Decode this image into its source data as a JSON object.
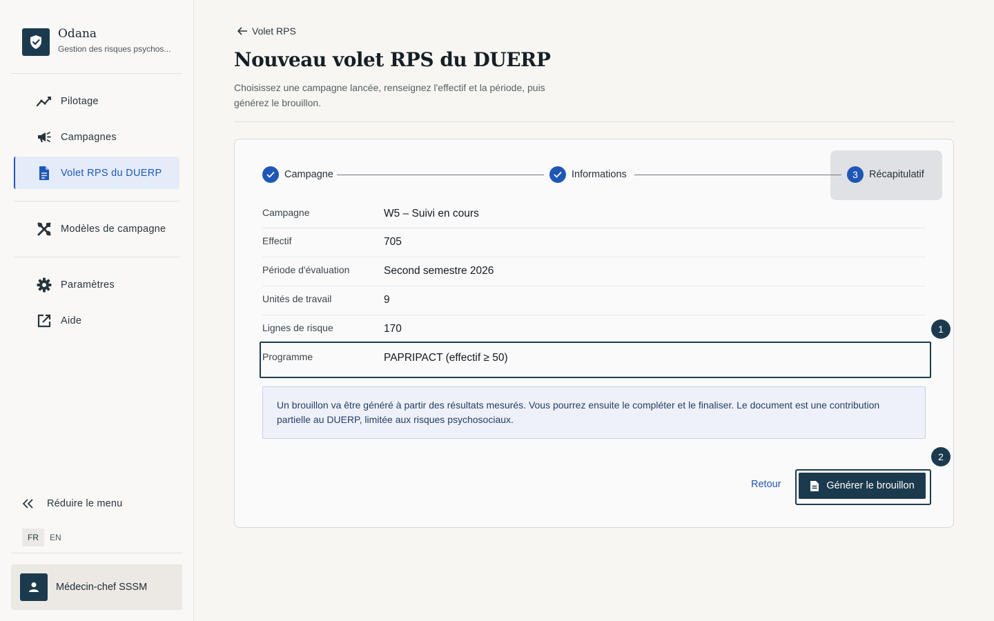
{
  "brand": {
    "name": "Odana",
    "subtitle": "Gestion des risques psychos..."
  },
  "sidebar": {
    "items": [
      {
        "label": "Pilotage",
        "icon": "chart-line-icon"
      },
      {
        "label": "Campagnes",
        "icon": "megaphone-icon"
      },
      {
        "label": "Volet RPS du DUERP",
        "icon": "document-icon",
        "active": true
      },
      {
        "label": "Modèles de campagne",
        "icon": "tools-icon"
      },
      {
        "label": "Paramètres",
        "icon": "gear-icon"
      },
      {
        "label": "Aide",
        "icon": "external-link-icon"
      }
    ],
    "collapse_label": "Réduire le menu",
    "languages": [
      "FR",
      "EN"
    ],
    "active_language": "FR",
    "user_name": "Médecin-chef SSSM"
  },
  "header": {
    "back_label": "Volet RPS",
    "title": "Nouveau volet RPS du DUERP",
    "description": "Choisissez une campagne lancée, renseignez l'effectif et la période, puis générez le brouillon."
  },
  "stepper": {
    "steps": [
      {
        "label": "Campagne",
        "state": "done"
      },
      {
        "label": "Informations",
        "state": "done"
      },
      {
        "label": "Récapitulatif",
        "state": "current",
        "number": "3"
      }
    ]
  },
  "summary": {
    "rows": [
      {
        "label": "Campagne",
        "value": "W5 – Suivi en cours"
      },
      {
        "label": "Effectif",
        "value": "705"
      },
      {
        "label": "Période d'évaluation",
        "value": "Second semestre 2026"
      },
      {
        "label": "Unités de travail",
        "value": "9"
      },
      {
        "label": "Lignes de risque",
        "value": "170"
      },
      {
        "label": "Programme",
        "value": "PAPRIPACT (effectif ≥ 50)"
      }
    ]
  },
  "info_text": "Un brouillon va être généré à partir des résultats mesurés. Vous pourrez ensuite le compléter et le finaliser. Le document est une contribution partielle au DUERP, limitée aux risques psychosociaux.",
  "actions": {
    "back_label": "Retour",
    "generate_label": "Générer le brouillon"
  },
  "annotations": [
    "1",
    "2"
  ],
  "colors": {
    "primary": "#1c3a4d",
    "accent": "#1f57b6",
    "info_bg": "#eef1fa"
  }
}
